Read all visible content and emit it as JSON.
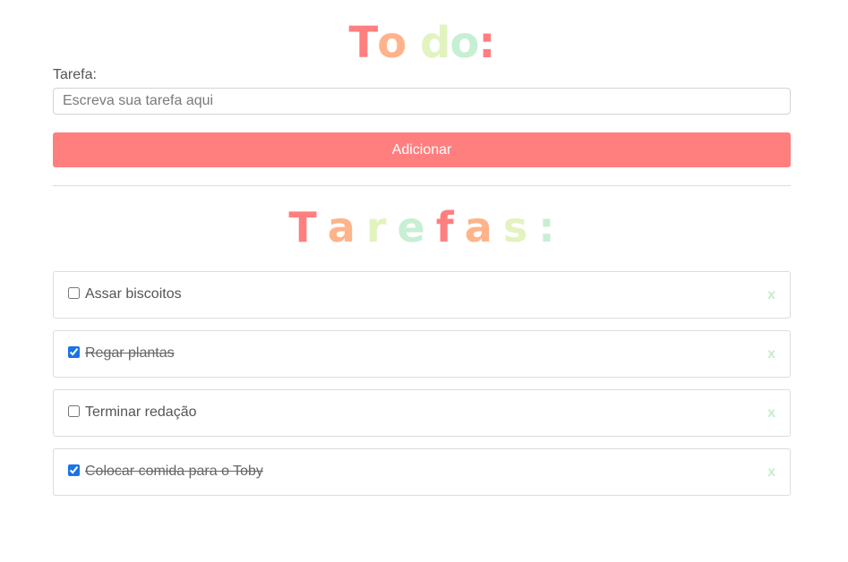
{
  "header": {
    "title_letters": [
      {
        "char": "T",
        "color": "#ff7f7f"
      },
      {
        "char": "o",
        "color": "#ffb38a"
      },
      {
        "char": " ",
        "color": "#ffffff"
      },
      {
        "char": "d",
        "color": "#e2f3bf"
      },
      {
        "char": "o",
        "color": "#c7efd3"
      },
      {
        "char": ":",
        "color": "#ff7f7f"
      }
    ]
  },
  "form": {
    "label": "Tarefa:",
    "input_value": "",
    "input_placeholder": "Escreva sua tarefa aqui",
    "add_button_label": "Adicionar",
    "add_button_color": "#ff7f7f"
  },
  "tasks_section": {
    "title_letters": [
      {
        "char": "T",
        "color": "#ff7f7f"
      },
      {
        "char": "a",
        "color": "#ffb38a"
      },
      {
        "char": "r",
        "color": "#e2f3bf"
      },
      {
        "char": "e",
        "color": "#c7efd3"
      },
      {
        "char": "f",
        "color": "#ff7f7f"
      },
      {
        "char": "a",
        "color": "#ffb38a"
      },
      {
        "char": "s",
        "color": "#e2f3bf"
      },
      {
        "char": ":",
        "color": "#c7efd3"
      }
    ],
    "remove_label": "x",
    "remove_color": "#c3edcf"
  },
  "tasks": [
    {
      "text": "Assar biscoitos",
      "done": false
    },
    {
      "text": "Regar plantas",
      "done": true
    },
    {
      "text": "Terminar redação",
      "done": false
    },
    {
      "text": "Colocar comida para o Toby",
      "done": true
    }
  ]
}
